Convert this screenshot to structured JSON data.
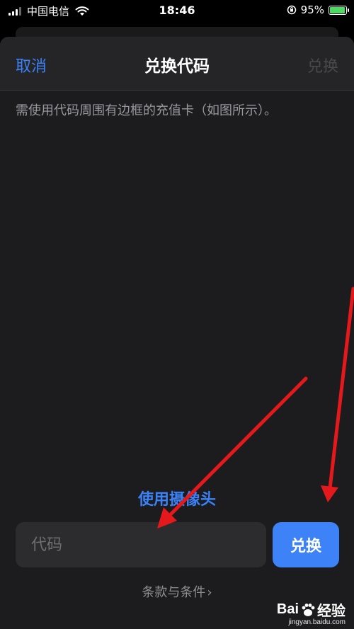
{
  "status_bar": {
    "carrier": "中国电信",
    "time": "18:46",
    "battery_percent": "95%",
    "battery_level": 0.95
  },
  "nav": {
    "cancel_label": "取消",
    "title": "兑换代码",
    "redeem_label": "兑换"
  },
  "hint_text": "需使用代码周围有边框的充值卡（如图所示）。",
  "camera_link_label": "使用摄像头",
  "code_input": {
    "placeholder": "代码",
    "value": ""
  },
  "redeem_button_label": "兑换",
  "terms": {
    "label": "条款与条件",
    "chevron": "›"
  },
  "watermark": {
    "brand_a": "Bai",
    "brand_b": "经验",
    "url": "jingyan.baidu.com"
  },
  "colors": {
    "accent": "#3b82f6",
    "annotation_arrow": "#e5191c",
    "sheet_background": "#1c1c1e"
  }
}
